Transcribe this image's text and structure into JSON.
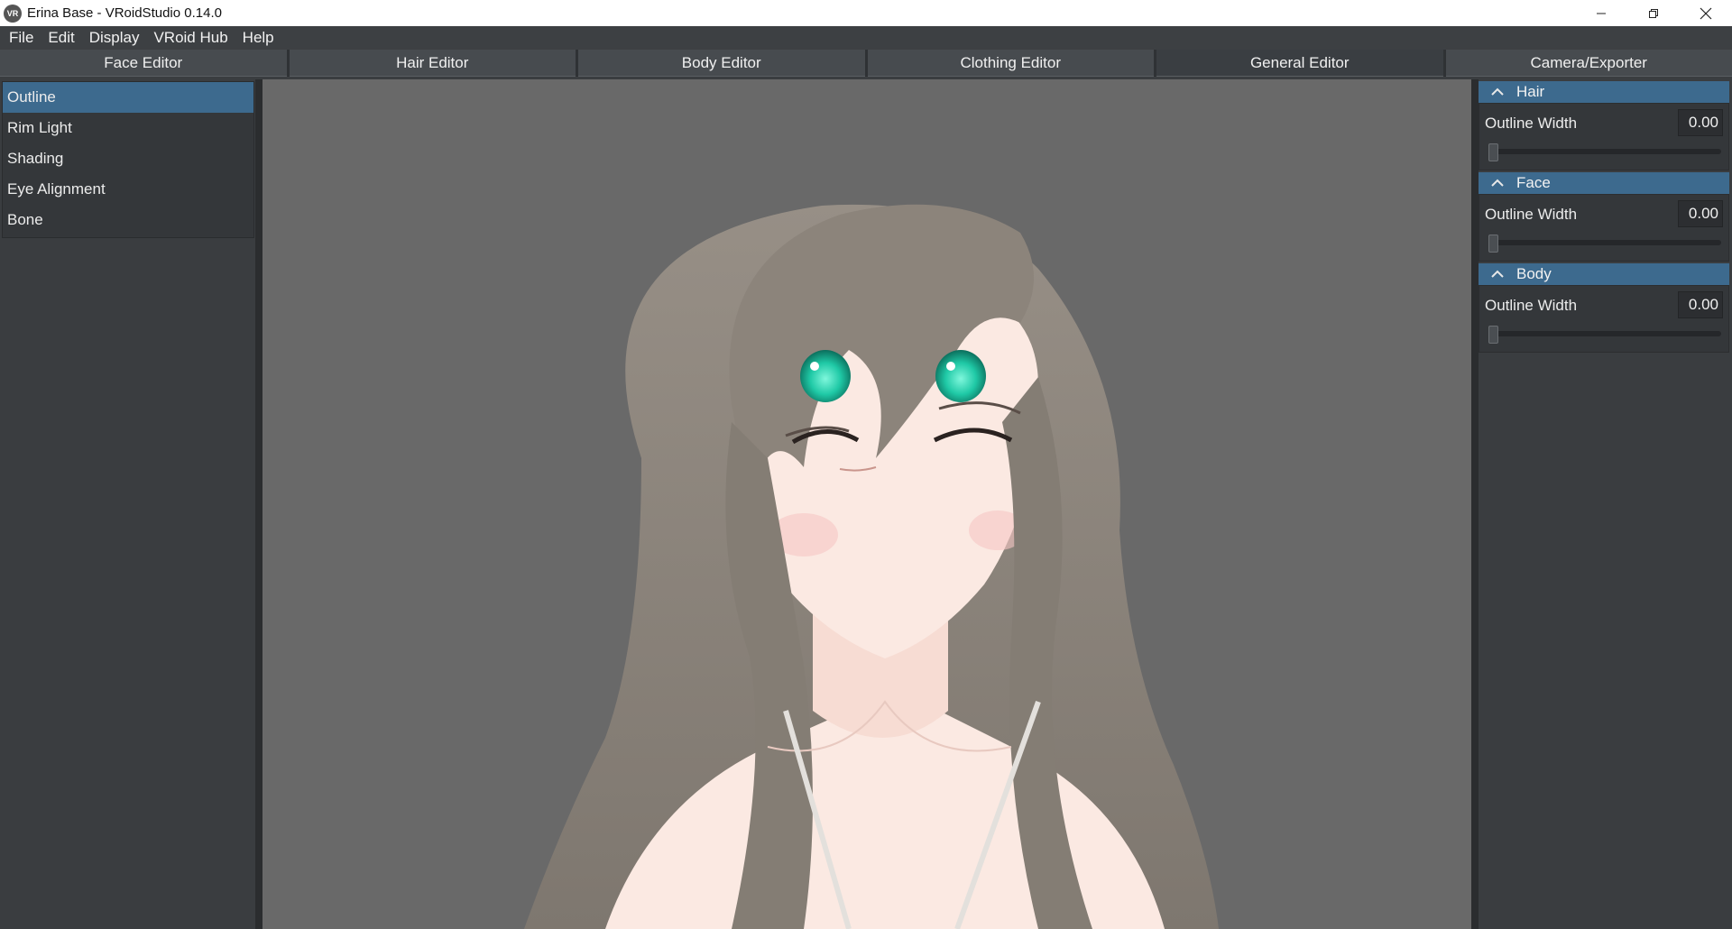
{
  "window": {
    "title": "Erina Base - VRoidStudio 0.14.0",
    "app_icon_label": "VR"
  },
  "menu": [
    "File",
    "Edit",
    "Display",
    "VRoid Hub",
    "Help"
  ],
  "tabs": [
    {
      "label": "Face Editor",
      "active": false
    },
    {
      "label": "Hair Editor",
      "active": false
    },
    {
      "label": "Body Editor",
      "active": false
    },
    {
      "label": "Clothing Editor",
      "active": false
    },
    {
      "label": "General Editor",
      "active": true
    },
    {
      "label": "Camera/Exporter",
      "active": false
    }
  ],
  "left_menu": [
    {
      "label": "Outline",
      "selected": true
    },
    {
      "label": "Rim Light",
      "selected": false
    },
    {
      "label": "Shading",
      "selected": false
    },
    {
      "label": "Eye Alignment",
      "selected": false
    },
    {
      "label": "Bone",
      "selected": false
    }
  ],
  "sections": [
    {
      "title": "Hair",
      "param_label": "Outline Width",
      "value": "0.00",
      "slider_fraction": 0.0
    },
    {
      "title": "Face",
      "param_label": "Outline Width",
      "value": "0.00",
      "slider_fraction": 0.0
    },
    {
      "title": "Body",
      "param_label": "Outline Width",
      "value": "0.00",
      "slider_fraction": 0.0
    }
  ],
  "colors": {
    "accent": "#3d6a8e",
    "viewport_bg": "#696969",
    "hair": "#8c847b",
    "skin": "#fbe9e2",
    "eyes": "#1fc9a6"
  },
  "icons": {
    "minimize": "minimize-icon",
    "maximize": "restore-icon",
    "close": "close-icon",
    "section_toggle": "chevron-up-icon"
  }
}
